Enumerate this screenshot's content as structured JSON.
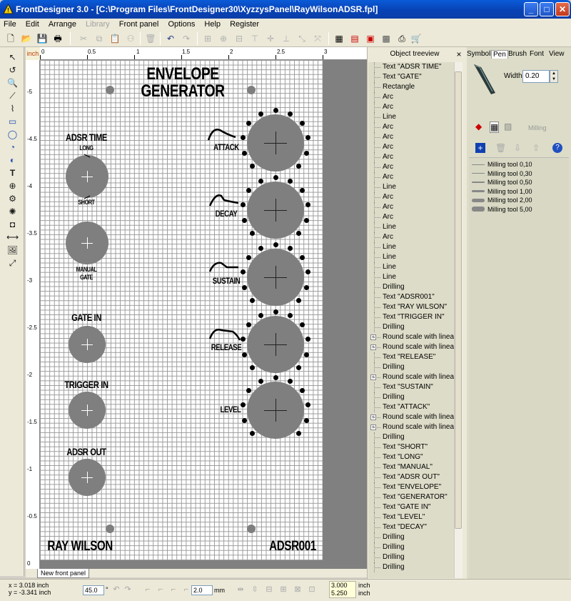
{
  "window": {
    "title": "FrontDesigner 3.0 - [C:\\Program Files\\FrontDesigner30\\XyzzysPanel\\RayWilsonADSR.fpl]",
    "minimize": "_",
    "maximize": "□",
    "close": "✕"
  },
  "menu": {
    "items": [
      "File",
      "Edit",
      "Arrange",
      "Library",
      "Front panel",
      "Options",
      "Help",
      "Register"
    ],
    "disabled": [
      "Library"
    ]
  },
  "ruler": {
    "unit": "inch",
    "top_labels": [
      "0",
      "0.5",
      "1",
      "1.5",
      "2",
      "2.5",
      "3"
    ],
    "left_labels": [
      "-5",
      "-4.5",
      "-4",
      "-3.5",
      "-3",
      "-2.5",
      "-2",
      "-1.5",
      "-1",
      "-0.5",
      "0"
    ]
  },
  "panel": {
    "title_line1": "ENVELOPE",
    "title_line2": "GENERATOR",
    "adsr_time": "ADSR TIME",
    "long": "LONG",
    "short": "SHORT",
    "manual": "MANUAL",
    "gate": "GATE",
    "gate_in": "GATE IN",
    "trigger_in": "TRIGGER IN",
    "adsr_out": "ADSR OUT",
    "attack": "ATTACK",
    "decay": "DECAY",
    "sustain": "SUSTAIN",
    "release": "RELEASE",
    "level": "LEVEL",
    "footer_left": "RAY WILSON",
    "footer_right": "ADSR001",
    "fill_color": "#7f7f7f"
  },
  "tabs": {
    "front_panel": "New front panel"
  },
  "treeview": {
    "title": "Object treeview",
    "items": [
      {
        "label": "Text \"ADSR TIME\"",
        "expand": false
      },
      {
        "label": "Text \"GATE\"",
        "expand": false
      },
      {
        "label": "Rectangle",
        "expand": false
      },
      {
        "label": "Arc",
        "expand": false
      },
      {
        "label": "Arc",
        "expand": false
      },
      {
        "label": "Line",
        "expand": false
      },
      {
        "label": "Arc",
        "expand": false
      },
      {
        "label": "Arc",
        "expand": false
      },
      {
        "label": "Arc",
        "expand": false
      },
      {
        "label": "Arc",
        "expand": false
      },
      {
        "label": "Arc",
        "expand": false
      },
      {
        "label": "Arc",
        "expand": false
      },
      {
        "label": "Line",
        "expand": false
      },
      {
        "label": "Arc",
        "expand": false
      },
      {
        "label": "Arc",
        "expand": false
      },
      {
        "label": "Arc",
        "expand": false
      },
      {
        "label": "Line",
        "expand": false
      },
      {
        "label": "Arc",
        "expand": false
      },
      {
        "label": "Line",
        "expand": false
      },
      {
        "label": "Line",
        "expand": false
      },
      {
        "label": "Line",
        "expand": false
      },
      {
        "label": "Line",
        "expand": false
      },
      {
        "label": "Drilling",
        "expand": false
      },
      {
        "label": "Text \"ADSR001\"",
        "expand": false
      },
      {
        "label": "Text \"RAY WILSON\"",
        "expand": false
      },
      {
        "label": "Text \"TRIGGER IN\"",
        "expand": false
      },
      {
        "label": "Drilling",
        "expand": false
      },
      {
        "label": "Round scale with linea",
        "expand": true
      },
      {
        "label": "Round scale with linea",
        "expand": true
      },
      {
        "label": "Text \"RELEASE\"",
        "expand": false
      },
      {
        "label": "Drilling",
        "expand": false
      },
      {
        "label": "Round scale with linea",
        "expand": true
      },
      {
        "label": "Text \"SUSTAIN\"",
        "expand": false
      },
      {
        "label": "Drilling",
        "expand": false
      },
      {
        "label": "Text \"ATTACK\"",
        "expand": false
      },
      {
        "label": "Round scale with linea",
        "expand": true
      },
      {
        "label": "Round scale with linea",
        "expand": true
      },
      {
        "label": "Drilling",
        "expand": false
      },
      {
        "label": "Text \"SHORT\"",
        "expand": false
      },
      {
        "label": "Text \"LONG\"",
        "expand": false
      },
      {
        "label": "Text \"MANUAL\"",
        "expand": false
      },
      {
        "label": "Text \"ADSR OUT\"",
        "expand": false
      },
      {
        "label": "Text \"ENVELOPE\"",
        "expand": false
      },
      {
        "label": "Text \"GENERATOR\"",
        "expand": false
      },
      {
        "label": "Text \"GATE IN\"",
        "expand": false
      },
      {
        "label": "Text \"LEVEL\"",
        "expand": false
      },
      {
        "label": "Text \"DECAY\"",
        "expand": false
      },
      {
        "label": "Drilling",
        "expand": false
      },
      {
        "label": "Drilling",
        "expand": false
      },
      {
        "label": "Drilling",
        "expand": false
      },
      {
        "label": "Drilling",
        "expand": false
      }
    ]
  },
  "properties": {
    "tabs": [
      "Symbols",
      "Pen",
      "Brush",
      "Font",
      "View"
    ],
    "active_tab": "Pen",
    "width_label": "Width:",
    "width_value": "0.20",
    "milling_label": "Milling",
    "tools": [
      {
        "label": "Milling tool 0,10",
        "thickness": 1
      },
      {
        "label": "Milling tool 0,30",
        "thickness": 1
      },
      {
        "label": "Milling tool 0,50",
        "thickness": 2
      },
      {
        "label": "Milling tool 1,00",
        "thickness": 3
      },
      {
        "label": "Milling tool 2,00",
        "thickness": 5
      },
      {
        "label": "Milling tool 5,00",
        "thickness": 7
      }
    ]
  },
  "status": {
    "x": "x = 3.018 inch",
    "y": "y = -3.341 inch",
    "angle": "45.0",
    "angle_unit": "°",
    "width": "2.0",
    "width_unit": "mm",
    "size_w": "3.000",
    "size_h": "5.250",
    "size_unit1": "inch",
    "size_unit2": "inch"
  }
}
